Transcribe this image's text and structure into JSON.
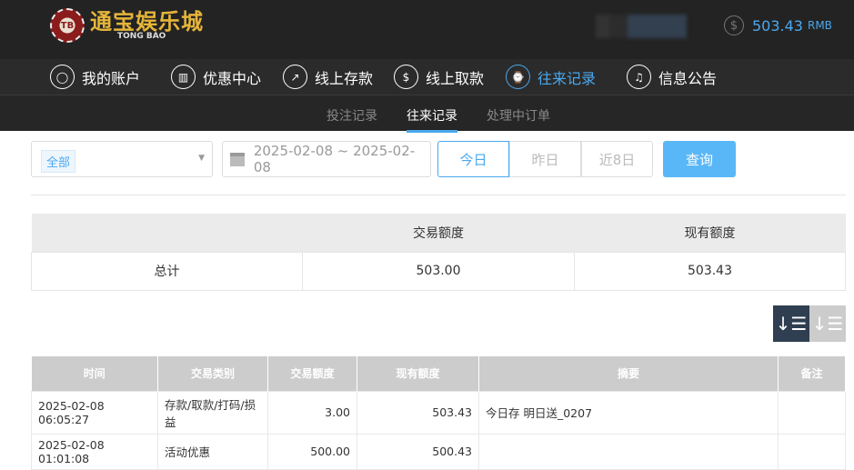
{
  "header": {
    "logo_cn": "通宝娱乐城",
    "logo_en": "TONG BAO",
    "logo_badge": "TB",
    "balance": "503.43",
    "currency": "RMB"
  },
  "nav": [
    {
      "label": "我的账户",
      "icon": "user-icon"
    },
    {
      "label": "优惠中心",
      "icon": "gift-icon"
    },
    {
      "label": "线上存款",
      "icon": "deposit-icon"
    },
    {
      "label": "线上取款",
      "icon": "withdraw-icon"
    },
    {
      "label": "往来记录",
      "icon": "record-icon",
      "active": true
    },
    {
      "label": "信息公告",
      "icon": "bell-icon"
    }
  ],
  "subnav": [
    {
      "label": "投注记录"
    },
    {
      "label": "往来记录",
      "active": true
    },
    {
      "label": "处理中订单"
    }
  ],
  "filter": {
    "type": "全部",
    "date_range": "2025-02-08 ~ 2025-02-08",
    "quick": [
      "今日",
      "昨日",
      "近8日"
    ],
    "search": "查询"
  },
  "summary": {
    "headers": [
      "",
      "交易额度",
      "现有额度"
    ],
    "row": [
      "总计",
      "503.00",
      "503.43"
    ]
  },
  "table": {
    "headers": [
      "时间",
      "交易类别",
      "交易额度",
      "现有额度",
      "摘要",
      "备注"
    ],
    "rows": [
      [
        "2025-02-08 06:05:27",
        "存款/取款/打码/损益",
        "3.00",
        "503.43",
        "今日存 明日送_0207",
        ""
      ],
      [
        "2025-02-08 01:01:08",
        "活动优惠",
        "500.00",
        "500.43",
        "",
        ""
      ]
    ]
  },
  "colors": {
    "accent": "#4aa8ee",
    "header_bg": "#232323"
  }
}
